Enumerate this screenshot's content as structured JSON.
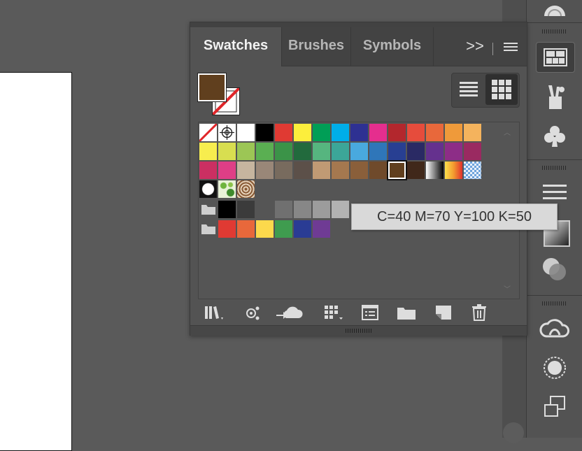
{
  "panel": {
    "tabs": [
      {
        "label": "Swatches",
        "active": true
      },
      {
        "label": "Brushes",
        "active": false
      },
      {
        "label": "Symbols",
        "active": false
      }
    ],
    "more_label": ">>",
    "fill_color": "#603f1e",
    "swatch_rows": [
      [
        "none",
        "registration",
        "#ffffff",
        "#000000",
        "#e03a33",
        "#fcee3c",
        "#009e56",
        "#00aee8",
        "#2e3192",
        "#e52e8e",
        "#b3272d",
        "#e64c3c",
        "#e8683b",
        "#ef9a3a",
        "#f4b35d"
      ],
      [
        "#f7ed4e",
        "#d8de50",
        "#9cc655",
        "#5aaf52",
        "#3b9348",
        "#226a3d",
        "#56b57f",
        "#3ca698",
        "#49a9de",
        "#2f76b9",
        "#283f92",
        "#2a2a64",
        "#65318e",
        "#8d2d87",
        "#9a2a61"
      ],
      [
        "#cb2f62",
        "#de3e86",
        "#c6b59f",
        "#998778",
        "#786b5e",
        "#5c5049",
        "#c09a74",
        "#a5784f",
        "#8a5f3a",
        "#6f4a2b",
        "#603f1e",
        "#40281a",
        "gradient-bw",
        "gradient-orange",
        "checker-blue"
      ],
      [
        "pattern-dots",
        "pattern-leaves",
        "pattern-swirl"
      ]
    ],
    "gray_group": [
      "#000000",
      "#3b3b3b",
      "#555555",
      "#707070",
      "#878787",
      "#9c9c9c",
      "#b2b2b2"
    ],
    "color_group": [
      "#e03a33",
      "#e8683b",
      "#fcd94c",
      "#3f9c4f",
      "#2a3c94",
      "#6f3b94"
    ],
    "tooltip": "C=40 M=70 Y=100 K=50"
  }
}
